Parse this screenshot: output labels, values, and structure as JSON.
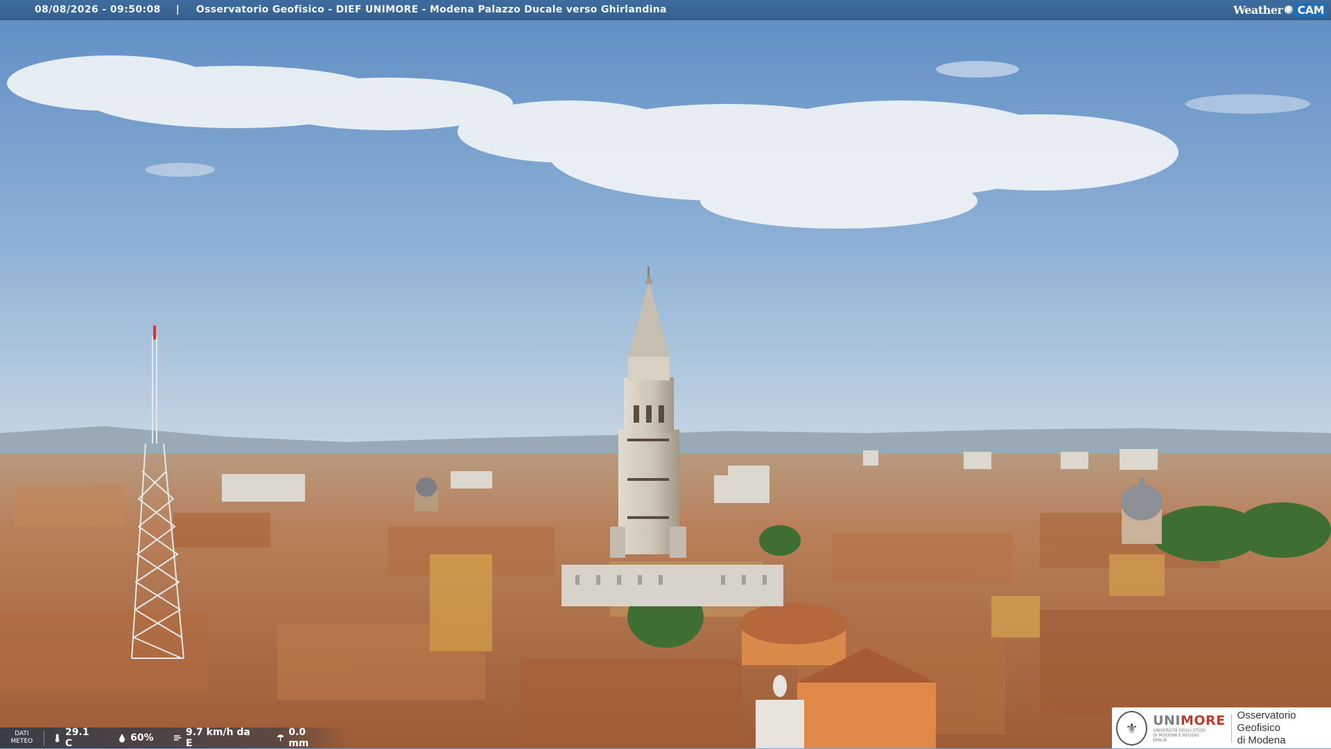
{
  "header": {
    "datetime": "08/08/2026 - 09:50:08",
    "separator": "|",
    "location": "Osservatorio Geofisico - DIEF UNIMORE - Modena Palazzo Ducale verso Ghirlandina"
  },
  "brand": {
    "weather": "Weather",
    "cam": "CAM"
  },
  "meteo": {
    "label_line1": "DATI",
    "label_line2": "METEO",
    "temperature": "29.1 C",
    "humidity": "60%",
    "wind": "9.7 km/h da E",
    "rain": "0.0 mm",
    "icons": [
      "thermometer-icon",
      "humidity-drop-icon",
      "wind-icon",
      "rain-gauge-icon"
    ]
  },
  "logo": {
    "uni_part1": "UNI",
    "uni_part2": "MORE",
    "uni_sub": "UNIVERSITÀ DEGLI STUDI DI MODENA E REGGIO EMILIA",
    "obs_line1": "Osservatorio Geofisico",
    "obs_line2": "di Modena"
  },
  "colors": {
    "sky_top": "#5f8fc6",
    "sky_bottom": "#b9cde0",
    "roof": "#b06a3c",
    "tower": "#cfc6b8",
    "brand_red": "#c0392b"
  }
}
